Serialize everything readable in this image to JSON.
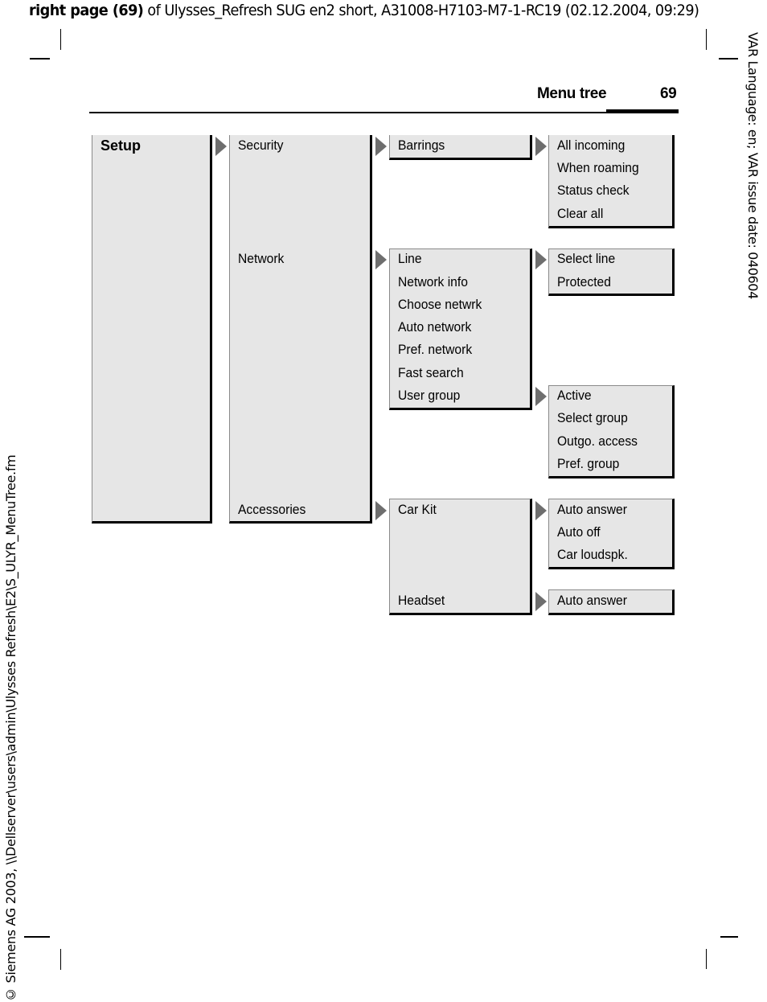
{
  "header": {
    "bold_part": "right page (69)",
    "rest": " of Ulysses_Refresh SUG en2 short, A31008-H7103-M7-1-RC19 (02.12.2004, 09:29)"
  },
  "side_right": "VAR Language: en; VAR issue date: 040604",
  "side_left": "© Siemens AG 2003, \\\\Dellserver\\users\\admin\\Ulysses Refresh\\E2\\S_ULYR_MenuTree.fm",
  "running_head": {
    "title": "Menu tree",
    "page_number": "69"
  },
  "menu_tree": {
    "root": "Setup",
    "level2": [
      "Security",
      "Network",
      "Accessories"
    ],
    "security": {
      "items": [
        "Barrings"
      ],
      "barrings": [
        "All incoming",
        "When roaming",
        "Status check",
        "Clear all"
      ]
    },
    "network": {
      "items": [
        "Line",
        "Network info",
        "Choose netwrk",
        "Auto network",
        "Pref. network",
        "Fast search",
        "User group"
      ],
      "line": [
        "Select line",
        "Protected"
      ],
      "user_group": [
        "Active",
        "Select group",
        "Outgo. access",
        "Pref. group"
      ]
    },
    "accessories": {
      "items": [
        "Car Kit",
        "Headset"
      ],
      "car_kit": [
        "Auto answer",
        "Auto off",
        "Car loudspk."
      ],
      "headset": [
        "Auto answer"
      ]
    },
    "arrow_color": "#6e6e6e",
    "box_fill": "#e6e6e6"
  }
}
